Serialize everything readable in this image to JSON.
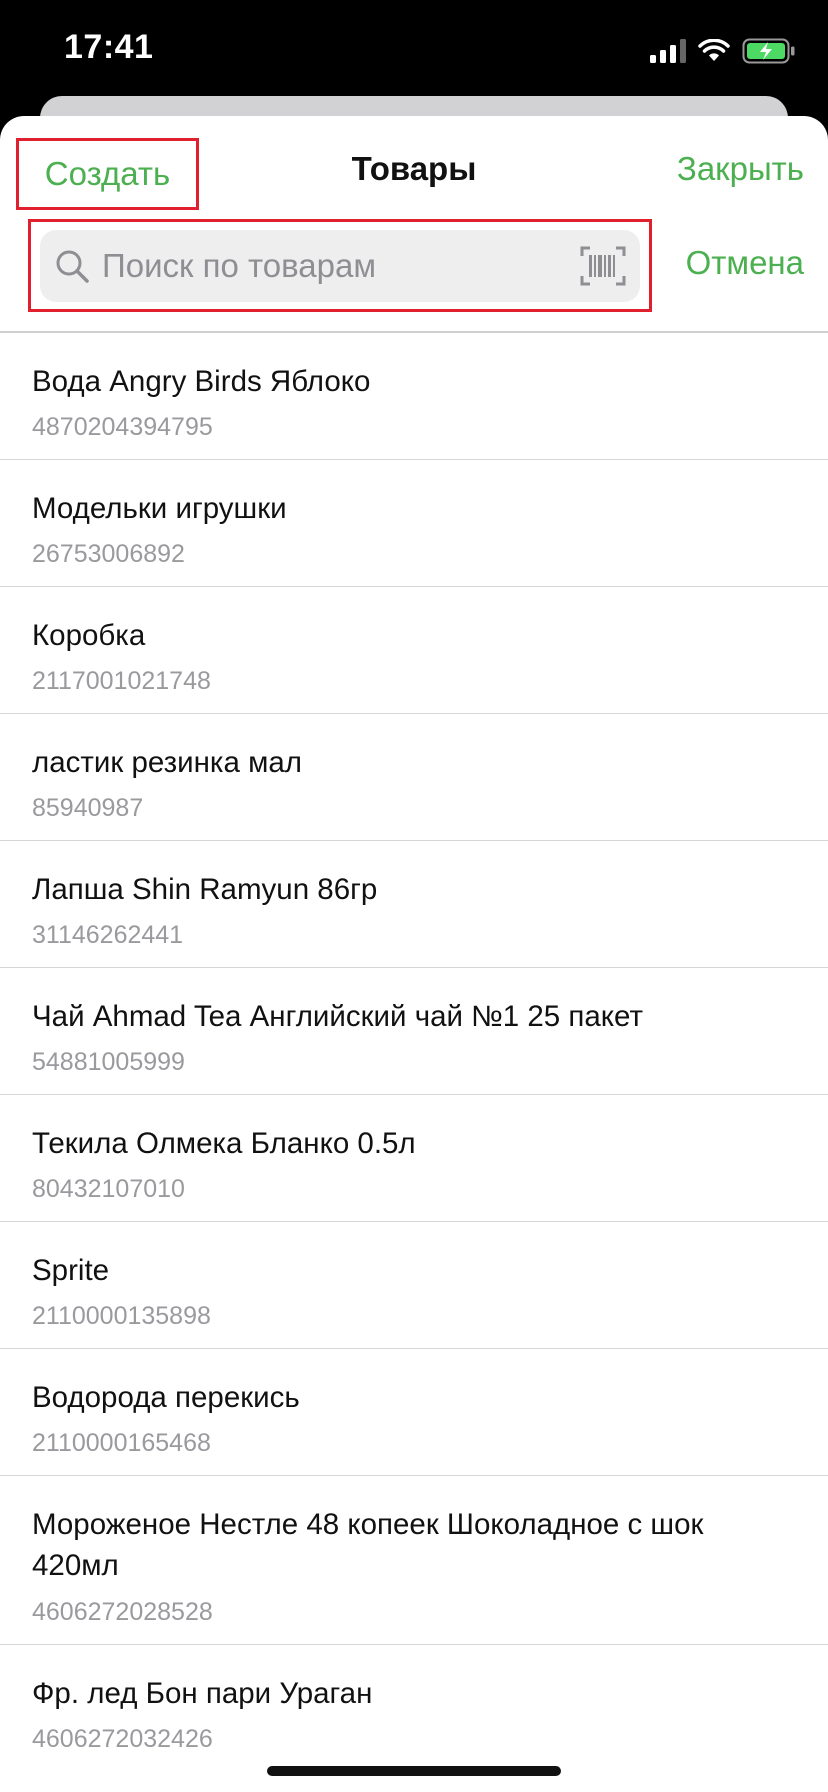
{
  "status_bar": {
    "time": "17:41",
    "icons": [
      "signal-icon",
      "wifi-icon",
      "battery-charging-icon"
    ],
    "battery_color": "#4cd964"
  },
  "nav": {
    "create_label": "Создать",
    "title": "Товары",
    "close_label": "Закрыть"
  },
  "search": {
    "placeholder": "Поиск по товарам",
    "value": "",
    "cancel_label": "Отмена"
  },
  "colors": {
    "accent": "#4caf50",
    "highlight": "#e0202e"
  },
  "products": [
    {
      "name": "Вода Angry Birds Яблоко",
      "code": "4870204394795"
    },
    {
      "name": "Модельки игрушки",
      "code": "26753006892"
    },
    {
      "name": "Коробка",
      "code": "2117001021748"
    },
    {
      "name": "ластик резинка мал",
      "code": "85940987"
    },
    {
      "name": "Лапша Shin Ramyun 86гр",
      "code": "31146262441"
    },
    {
      "name": "Чай Ahmad Tea Английский чай №1 25 пакет",
      "code": "54881005999"
    },
    {
      "name": "Текила Олмека Бланко 0.5л",
      "code": "80432107010"
    },
    {
      "name": "Sprite",
      "code": "2110000135898"
    },
    {
      "name": "Водорода перекись",
      "code": "2110000165468"
    },
    {
      "name": "Мороженое Нестле 48 копеек Шоколадное с шок 420мл",
      "code": "4606272028528"
    },
    {
      "name": "Фр. лед Бон пари Ураган",
      "code": "4606272032426"
    }
  ]
}
